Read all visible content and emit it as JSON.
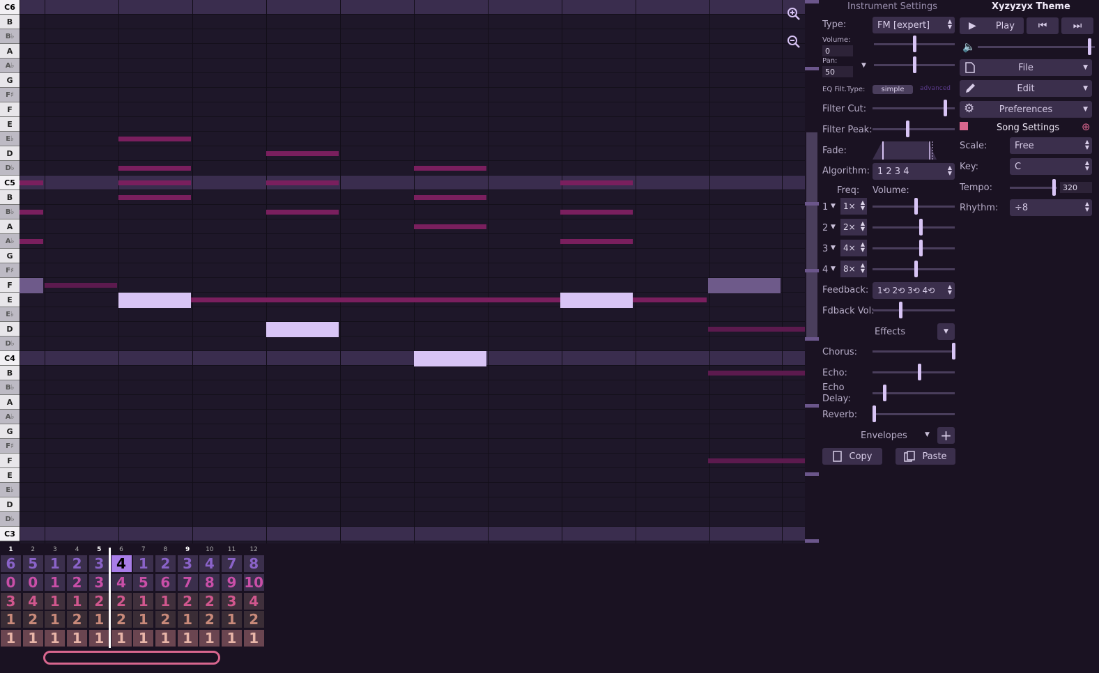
{
  "keyboard": {
    "keys": [
      {
        "label": "C6",
        "type": "c"
      },
      {
        "label": "B",
        "type": "white"
      },
      {
        "label": "B♭",
        "type": "black"
      },
      {
        "label": "A",
        "type": "white"
      },
      {
        "label": "A♭",
        "type": "black"
      },
      {
        "label": "G",
        "type": "white"
      },
      {
        "label": "F♯",
        "type": "black"
      },
      {
        "label": "F",
        "type": "white"
      },
      {
        "label": "E",
        "type": "white"
      },
      {
        "label": "E♭",
        "type": "black"
      },
      {
        "label": "D",
        "type": "white"
      },
      {
        "label": "D♭",
        "type": "black"
      },
      {
        "label": "C5",
        "type": "c"
      },
      {
        "label": "B",
        "type": "white"
      },
      {
        "label": "B♭",
        "type": "black"
      },
      {
        "label": "A",
        "type": "white"
      },
      {
        "label": "A♭",
        "type": "black"
      },
      {
        "label": "G",
        "type": "white"
      },
      {
        "label": "F♯",
        "type": "black"
      },
      {
        "label": "F",
        "type": "white"
      },
      {
        "label": "E",
        "type": "white"
      },
      {
        "label": "E♭",
        "type": "black"
      },
      {
        "label": "D",
        "type": "white"
      },
      {
        "label": "D♭",
        "type": "black"
      },
      {
        "label": "C4",
        "type": "c"
      },
      {
        "label": "B",
        "type": "white"
      },
      {
        "label": "B♭",
        "type": "black"
      },
      {
        "label": "A",
        "type": "white"
      },
      {
        "label": "A♭",
        "type": "black"
      },
      {
        "label": "G",
        "type": "white"
      },
      {
        "label": "F♯",
        "type": "black"
      },
      {
        "label": "F",
        "type": "white"
      },
      {
        "label": "E",
        "type": "white"
      },
      {
        "label": "E♭",
        "type": "black"
      },
      {
        "label": "D",
        "type": "white"
      },
      {
        "label": "D♭",
        "type": "black"
      },
      {
        "label": "C3",
        "type": "c"
      }
    ]
  },
  "instrument": {
    "header": "Instrument Settings",
    "type_label": "Type:",
    "type_value": "FM [expert]",
    "volume_label": "Volume:",
    "volume_value": "0",
    "pan_label": "Pan:",
    "pan_value": "50",
    "eq_label": "EQ Filt.Type:",
    "eq_simple": "simple",
    "eq_advanced": "advanced",
    "filter_cut_label": "Filter Cut:",
    "filter_peak_label": "Filter Peak:",
    "fade_label": "Fade:",
    "algorithm_label": "Algorithm:",
    "algorithm_value": "1  2  3  4",
    "freq_label": "Freq:",
    "volume2_label": "Volume:",
    "operators": [
      {
        "num": "1",
        "freq": "1×"
      },
      {
        "num": "2",
        "freq": "2×"
      },
      {
        "num": "3",
        "freq": "4×"
      },
      {
        "num": "4",
        "freq": "8×"
      }
    ],
    "feedback_label": "Feedback:",
    "feedback_value": "1⟲ 2⟲ 3⟲ 4⟲",
    "fdback_vol_label": "Fdback Vol:",
    "effects_label": "Effects",
    "chorus_label": "Chorus:",
    "echo_label": "Echo:",
    "echo_delay_label": "Echo Delay:",
    "reverb_label": "Reverb:",
    "envelopes_label": "Envelopes",
    "copy_label": "Copy",
    "paste_label": "Paste"
  },
  "song": {
    "theme_title": "Xyzyzyx Theme",
    "play_label": "Play",
    "file_label": "File",
    "edit_label": "Edit",
    "preferences_label": "Preferences",
    "song_settings_label": "Song Settings",
    "scale_label": "Scale:",
    "scale_value": "Free",
    "key_label": "Key:",
    "key_value": "C",
    "tempo_label": "Tempo:",
    "tempo_value": "320",
    "rhythm_label": "Rhythm:",
    "rhythm_value": "÷8"
  },
  "tracks": {
    "columns": [
      "1",
      "2",
      "3",
      "4",
      "5",
      "6",
      "7",
      "8",
      "9",
      "10",
      "11",
      "12"
    ],
    "rows": [
      {
        "color": "#8a63c9",
        "bg": "#3b2f4c",
        "values": [
          "6",
          "5",
          "1",
          "2",
          "3",
          "4",
          "1",
          "2",
          "3",
          "4",
          "7",
          "8"
        ]
      },
      {
        "color": "#c94fa8",
        "bg": "#3b2f4c",
        "values": [
          "0",
          "0",
          "1",
          "2",
          "3",
          "4",
          "5",
          "6",
          "7",
          "8",
          "9",
          "10"
        ]
      },
      {
        "color": "#d1578e",
        "bg": "#40303c",
        "values": [
          "3",
          "4",
          "1",
          "1",
          "2",
          "2",
          "1",
          "1",
          "2",
          "2",
          "3",
          "4"
        ]
      },
      {
        "color": "#c98a7a",
        "bg": "#3a2d36",
        "values": [
          "1",
          "2",
          "1",
          "2",
          "1",
          "2",
          "1",
          "2",
          "1",
          "2",
          "1",
          "2"
        ]
      },
      {
        "color": "#e8b5a8",
        "bg": "#6a4550",
        "values": [
          "1",
          "1",
          "1",
          "1",
          "1",
          "1",
          "1",
          "1",
          "1",
          "1",
          "1",
          "1"
        ]
      }
    ]
  },
  "colors": {
    "background": "#1a1222",
    "note_main": "#d8c4f5",
    "note_ghost": "#7a1f5e",
    "accent": "#d8668e"
  }
}
